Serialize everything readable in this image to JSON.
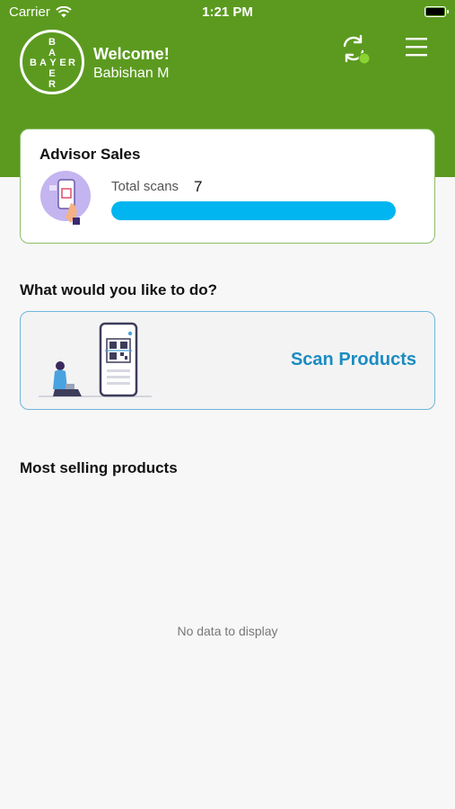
{
  "status_bar": {
    "carrier": "Carrier",
    "time": "1:21 PM"
  },
  "brand": {
    "logo_letters_horizontal": "BAYER",
    "logo_letters_vertical": "BAYER",
    "color": "#5b9a1f"
  },
  "header": {
    "welcome": "Welcome!",
    "user_name": "Babishan M",
    "sync_icon": "sync-icon",
    "menu_icon": "hamburger-menu-icon",
    "sync_status_color": "#8bd332"
  },
  "advisor_card": {
    "title": "Advisor Sales",
    "scans_label": "Total scans",
    "scans_value": "7",
    "progress_fraction": 1.0,
    "progress_color": "#00b5f0"
  },
  "actions": {
    "heading": "What would you like to do?",
    "scan_products_label": "Scan Products",
    "accent_color": "#1a8cc2"
  },
  "most_selling": {
    "heading": "Most selling products",
    "empty_text": "No data to display"
  }
}
